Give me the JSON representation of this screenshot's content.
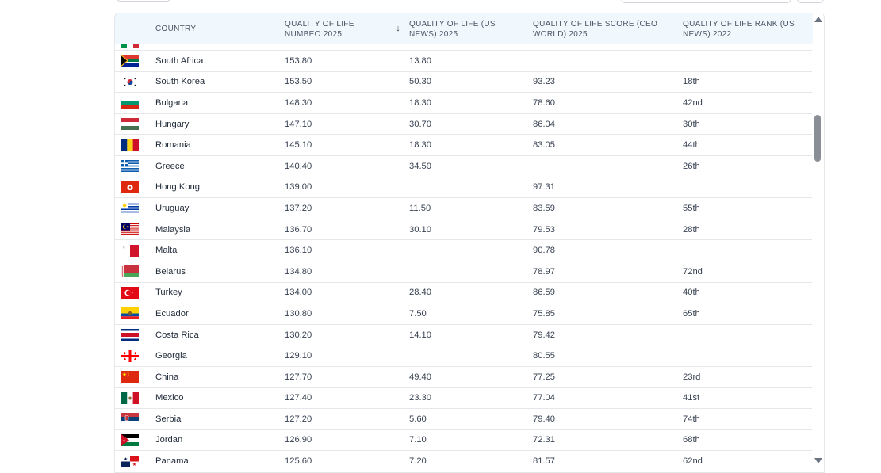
{
  "table": {
    "headers": {
      "country": "COUNTRY",
      "numbeo": "QUALITY OF LIFE NUMBEO 2025",
      "usnews": "QUALITY OF LIFE (US NEWS) 2025",
      "ceo": "QUALITY OF LIFE SCORE (CEO WORLD) 2025",
      "rank": "QUALITY OF LIFE RANK (US NEWS) 2022"
    },
    "sort_icon": "arrow-down-icon",
    "sort_glyph": "↓",
    "rows": [
      {
        "flag": "south-africa",
        "country": "South Africa",
        "numbeo": "153.80",
        "usnews": "13.80",
        "ceo": "",
        "rank": ""
      },
      {
        "flag": "south-korea",
        "country": "South Korea",
        "numbeo": "153.50",
        "usnews": "50.30",
        "ceo": "93.23",
        "rank": "18th"
      },
      {
        "flag": "bulgaria",
        "country": "Bulgaria",
        "numbeo": "148.30",
        "usnews": "18.30",
        "ceo": "78.60",
        "rank": "42nd"
      },
      {
        "flag": "hungary",
        "country": "Hungary",
        "numbeo": "147.10",
        "usnews": "30.70",
        "ceo": "86.04",
        "rank": "30th"
      },
      {
        "flag": "romania",
        "country": "Romania",
        "numbeo": "145.10",
        "usnews": "18.30",
        "ceo": "83.05",
        "rank": "44th"
      },
      {
        "flag": "greece",
        "country": "Greece",
        "numbeo": "140.40",
        "usnews": "34.50",
        "ceo": "",
        "rank": "26th"
      },
      {
        "flag": "hong-kong",
        "country": "Hong Kong",
        "numbeo": "139.00",
        "usnews": "",
        "ceo": "97.31",
        "rank": ""
      },
      {
        "flag": "uruguay",
        "country": "Uruguay",
        "numbeo": "137.20",
        "usnews": "11.50",
        "ceo": "83.59",
        "rank": "55th"
      },
      {
        "flag": "malaysia",
        "country": "Malaysia",
        "numbeo": "136.70",
        "usnews": "30.10",
        "ceo": "79.53",
        "rank": "28th"
      },
      {
        "flag": "malta",
        "country": "Malta",
        "numbeo": "136.10",
        "usnews": "",
        "ceo": "90.78",
        "rank": ""
      },
      {
        "flag": "belarus",
        "country": "Belarus",
        "numbeo": "134.80",
        "usnews": "",
        "ceo": "78.97",
        "rank": "72nd"
      },
      {
        "flag": "turkey",
        "country": "Turkey",
        "numbeo": "134.00",
        "usnews": "28.40",
        "ceo": "86.59",
        "rank": "40th"
      },
      {
        "flag": "ecuador",
        "country": "Ecuador",
        "numbeo": "130.80",
        "usnews": "7.50",
        "ceo": "75.85",
        "rank": "65th"
      },
      {
        "flag": "costa-rica",
        "country": "Costa Rica",
        "numbeo": "130.20",
        "usnews": "14.10",
        "ceo": "79.42",
        "rank": ""
      },
      {
        "flag": "georgia",
        "country": "Georgia",
        "numbeo": "129.10",
        "usnews": "",
        "ceo": "80.55",
        "rank": ""
      },
      {
        "flag": "china",
        "country": "China",
        "numbeo": "127.70",
        "usnews": "49.40",
        "ceo": "77.25",
        "rank": "23rd"
      },
      {
        "flag": "mexico",
        "country": "Mexico",
        "numbeo": "127.40",
        "usnews": "23.30",
        "ceo": "77.04",
        "rank": "41st"
      },
      {
        "flag": "serbia",
        "country": "Serbia",
        "numbeo": "127.20",
        "usnews": "5.60",
        "ceo": "79.40",
        "rank": "74th"
      },
      {
        "flag": "jordan",
        "country": "Jordan",
        "numbeo": "126.90",
        "usnews": "7.10",
        "ceo": "72.31",
        "rank": "68th"
      },
      {
        "flag": "panama",
        "country": "Panama",
        "numbeo": "125.60",
        "usnews": "7.20",
        "ceo": "81.57",
        "rank": "62nd"
      }
    ]
  },
  "colors": {
    "header_bg": "#f0f8fe",
    "row_border": "#e5e7eb",
    "scroll_thumb": "#8a8f96"
  }
}
